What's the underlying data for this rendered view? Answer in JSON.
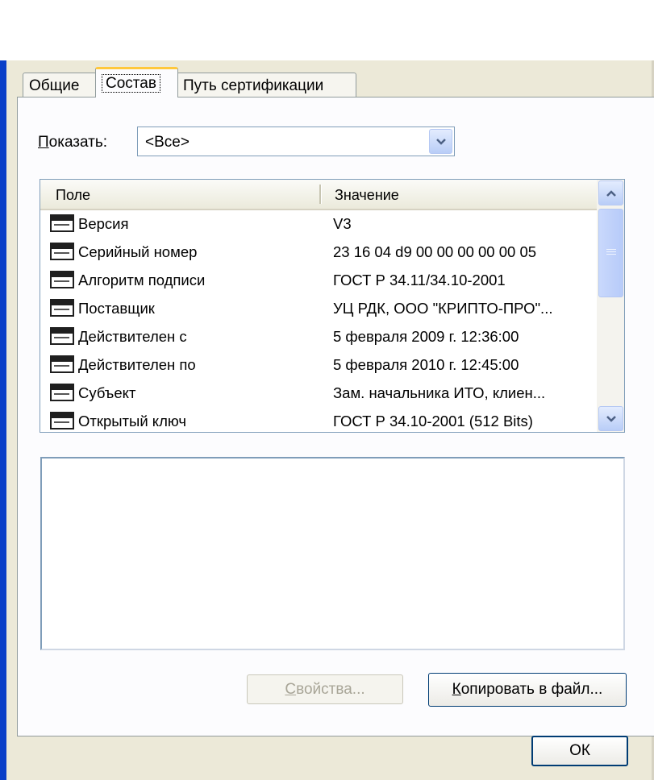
{
  "tabs": {
    "general": "Общие",
    "composition": "Состав",
    "certification_path": "Путь сертификации"
  },
  "show": {
    "label_first": "П",
    "label_rest": "оказать:",
    "selected": "<Все>"
  },
  "list": {
    "columns": {
      "field": "Поле",
      "value": "Значение"
    },
    "rows": [
      {
        "field": "Версия",
        "value": "V3"
      },
      {
        "field": "Серийный номер",
        "value": "23 16 04 d9 00 00 00 00 00 05"
      },
      {
        "field": "Алгоритм подписи",
        "value": "ГОСТ Р 34.11/34.10-2001"
      },
      {
        "field": "Поставщик",
        "value": "УЦ РДК, ООО \"КРИПТО-ПРО\"..."
      },
      {
        "field": "Действителен с",
        "value": "5 февраля 2009 г. 12:36:00"
      },
      {
        "field": "Действителен по",
        "value": "5 февраля 2010 г. 12:45:00"
      },
      {
        "field": "Субъект",
        "value": "Зам. начальника ИТО, клиен..."
      },
      {
        "field": "Открытый ключ",
        "value": "ГОСТ Р 34.10-2001 (512 Bits)"
      }
    ],
    "row_icon": "certificate-field-icon"
  },
  "buttons": {
    "properties_first": "С",
    "properties_rest": "войства...",
    "copy_first": "К",
    "copy_rest": "опировать в файл...",
    "ok": "ОК"
  },
  "colors": {
    "window_bg": "#ece9d8",
    "border_blue": "#7f9db9",
    "active_tab_accent": "#ffc83c",
    "disabled_text": "#a8a597"
  }
}
